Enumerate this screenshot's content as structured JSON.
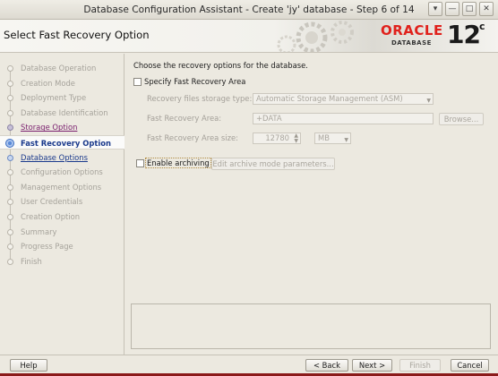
{
  "window": {
    "title": "Database Configuration Assistant - Create 'jy' database - Step 6 of 14",
    "buttons": [
      "▾",
      "—",
      "□",
      "✕"
    ]
  },
  "header": {
    "page_title": "Select Fast Recovery Option",
    "logo_oracle": "ORACLE",
    "logo_database": "DATABASE",
    "logo_version": "12",
    "logo_version_suffix": "c"
  },
  "nav": {
    "steps": [
      {
        "label": "Database Operation",
        "state": "disabled"
      },
      {
        "label": "Creation Mode",
        "state": "disabled"
      },
      {
        "label": "Deployment Type",
        "state": "disabled"
      },
      {
        "label": "Database Identification",
        "state": "disabled"
      },
      {
        "label": "Storage Option",
        "state": "done"
      },
      {
        "label": "Fast Recovery Option",
        "state": "current"
      },
      {
        "label": "Database Options",
        "state": "next"
      },
      {
        "label": "Configuration Options",
        "state": "disabled"
      },
      {
        "label": "Management Options",
        "state": "disabled"
      },
      {
        "label": "User Credentials",
        "state": "disabled"
      },
      {
        "label": "Creation Option",
        "state": "disabled"
      },
      {
        "label": "Summary",
        "state": "disabled"
      },
      {
        "label": "Progress Page",
        "state": "disabled"
      },
      {
        "label": "Finish",
        "state": "disabled"
      }
    ]
  },
  "main": {
    "intro": "Choose the recovery options for the database.",
    "specify_fra": {
      "label": "Specify Fast Recovery Area",
      "checked": false
    },
    "storage_type": {
      "label": "Recovery files storage type:",
      "value": "Automatic Storage Management (ASM)"
    },
    "fra": {
      "label": "Fast Recovery Area:",
      "value": "+DATA",
      "browse": "Browse..."
    },
    "fra_size": {
      "label": "Fast Recovery Area size:",
      "value": "12780",
      "unit": "MB"
    },
    "archiving": {
      "label": "Enable archiving",
      "checked": false,
      "edit_button": "Edit archive mode parameters..."
    }
  },
  "footer": {
    "help": "Help",
    "back": "< Back",
    "next": "Next >",
    "finish": "Finish",
    "cancel": "Cancel"
  }
}
